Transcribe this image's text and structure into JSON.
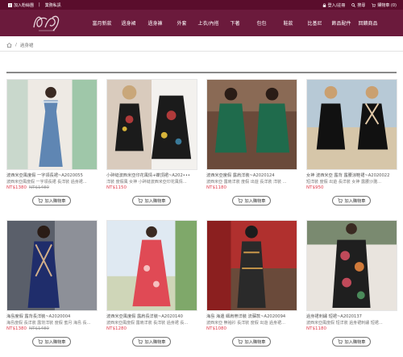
{
  "topbar": {
    "join_fb": "加入粉絲團",
    "contact_line": "加入聯絡人",
    "separator": "|",
    "customer_service": "業務私訊",
    "login": "登入/註冊",
    "search": "搜尋",
    "cart": "購物車 (0)"
  },
  "nav": {
    "items": [
      "當月新款",
      "過身裙",
      "過身褲",
      "外套",
      "上衣/內搭",
      "下著",
      "包包",
      "鞋款",
      "比基尼",
      "飾品配件",
      "回饋商品"
    ]
  },
  "breadcrumb": {
    "separator": "/",
    "current": "過身裙"
  },
  "products": [
    {
      "title": "波西米亞風度假 一字領長裙~A2020055",
      "desc": "波西米亞風度假 一字領長裙 長洋裝 過身裙…",
      "price": "NT$1380",
      "original_price": "NT$1480"
    },
    {
      "title": "小碎縫波西米亞印花風情+蝶頂裙~A202•••",
      "desc": "洋裝 度假風 女神 小碎縫波西米亞印花風情…",
      "price": "NT$1150",
      "original_price": ""
    },
    {
      "title": "波西米亞度假 露肩洋裝~A2020124",
      "desc": "波西米亞 露肩洋裝 度假 出遊 長洋裝 洋裝 …",
      "price": "NT$1180",
      "original_price": ""
    },
    {
      "title": "女神 波西米亞 露背 露腰涼鞋裙~A2020022",
      "desc": "短洋裝 度假 出遊 長洋裝 女神 露腰沙灘…",
      "price": "NT$950",
      "original_price": ""
    },
    {
      "title": "海島度假 露背長洋裝~A2020004",
      "desc": "海島度假 長洋裝 露背洋裝 度假 蜜月 海島 長…",
      "price": "NT$1380",
      "original_price": "NT$1480"
    },
    {
      "title": "波西米亞風度假 露肩長洋裝~A2020140",
      "desc": "波西米亞風度假 露肩洋裝 長洋裝 過身裙 長…",
      "price": "NT$1280",
      "original_price": ""
    },
    {
      "title": "海島 海邊 細肩帶洋裝 流蘇款~A2020094",
      "desc": "波西米亞 無袖衫 長洋裝 度假 出遊 過身裙…",
      "price": "NT$1080",
      "original_price": ""
    },
    {
      "title": "過身裙刺繡 短裙~A2020137",
      "desc": "波西米亞風度假 短洋裝 過身裙刺繡 短裙…",
      "price": "NT$1180",
      "original_price": ""
    }
  ],
  "cart_button_label": "加入購物車",
  "colors": {
    "topbar": "#5a0d2c",
    "navbar": "#6b1a3c",
    "price": "#e03a4a"
  }
}
